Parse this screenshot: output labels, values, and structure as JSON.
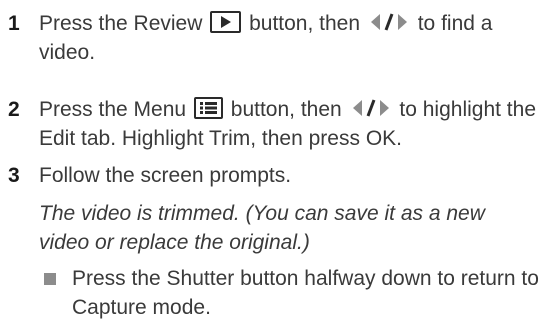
{
  "steps": [
    {
      "number": "1",
      "text_a": "Press the Review",
      "icon_review": "play-icon",
      "text_b": "button, then",
      "icon_nav": "left-right-arrows-icon",
      "text_c": "to find a video."
    },
    {
      "number": "2",
      "text_a": "Press the Menu",
      "icon_menu": "menu-icon",
      "text_b": "button, then",
      "icon_nav": "left-right-arrows-icon",
      "text_c": "to highlight the Edit tab. Highlight Trim, then press OK."
    },
    {
      "number": "3",
      "text": "Follow the screen prompts."
    }
  ],
  "result_note": "The video is trimmed. (You can save it as a new video or replace the original.)",
  "bullets": [
    "Press the Shutter button halfway down to return to Capture mode."
  ],
  "colors": {
    "text": "#3a3a3a",
    "bullet": "#8c8c8c",
    "icon_stroke": "#2a2a2a"
  }
}
